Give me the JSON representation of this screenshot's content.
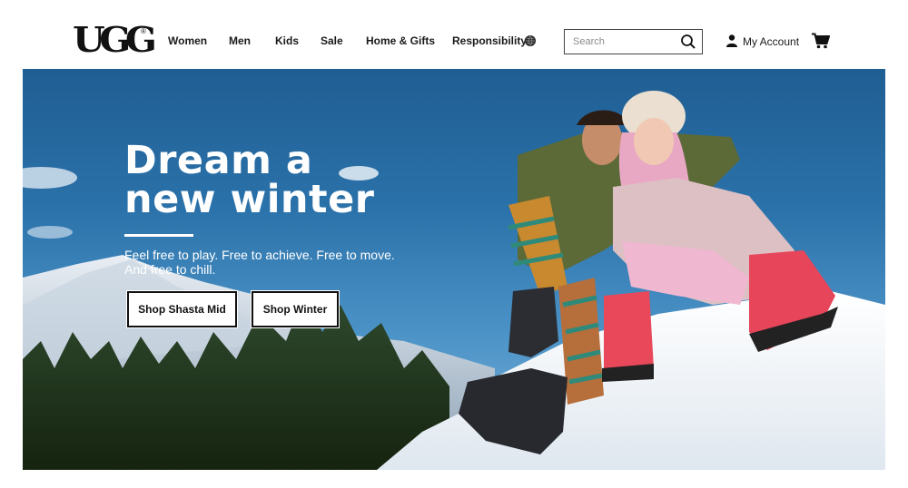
{
  "brand": {
    "logo_text": "UGG",
    "logo_mark": "®"
  },
  "nav": {
    "items": [
      {
        "label": "Women"
      },
      {
        "label": "Men"
      },
      {
        "label": "Kids"
      },
      {
        "label": "Sale"
      },
      {
        "label": "Home & Gifts"
      },
      {
        "label": "Responsibility"
      }
    ],
    "responsibility_icon": "globe-icon"
  },
  "search": {
    "placeholder": "Search",
    "value": "",
    "icon": "search-icon"
  },
  "account": {
    "label": "My Account",
    "icon": "user-icon"
  },
  "cart": {
    "icon": "cart-icon"
  },
  "hero": {
    "headline_line1": "Dream a",
    "headline_line2": "new winter",
    "subtext": "Feel free to play. Free to achieve. Free to move. And free to chill.",
    "cta_primary": "Shop Shasta Mid",
    "cta_secondary": "Shop Winter"
  },
  "colors": {
    "sky": "#2b72aa",
    "snow": "#f2f5f8",
    "text_dark": "#111111",
    "boot_red": "#e8485a"
  }
}
